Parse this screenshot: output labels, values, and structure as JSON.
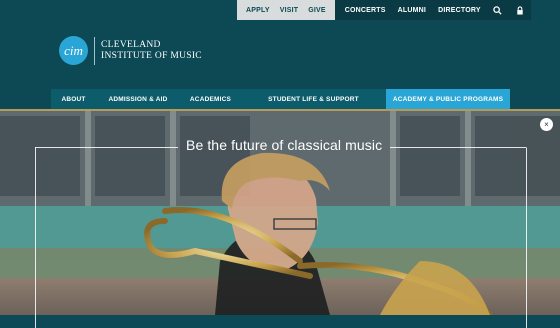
{
  "utility_nav": {
    "light": [
      "APPLY",
      "VISIT",
      "GIVE"
    ],
    "dark": [
      "CONCERTS",
      "ALUMNI",
      "DIRECTORY"
    ],
    "icons": [
      "search-icon",
      "lock-icon"
    ]
  },
  "logo": {
    "mark": "cim",
    "line1": "CLEVELAND",
    "line2": "INSTITUTE OF MUSIC"
  },
  "main_nav": {
    "items": [
      {
        "label": "ABOUT",
        "active": false
      },
      {
        "label": "ADMISSION & AID",
        "active": false
      },
      {
        "label": "ACADEMICS",
        "active": false
      },
      {
        "label": "STUDENT LIFE & SUPPORT",
        "active": false
      },
      {
        "label": "ACADEMY & PUBLIC PROGRAMS",
        "active": true
      }
    ]
  },
  "hero": {
    "title": "Be the future of classical music",
    "close_symbol": "×"
  },
  "colors": {
    "header_bg": "#0c4954",
    "accent_blue": "#2aa6d6",
    "gold": "#b59a5a"
  }
}
